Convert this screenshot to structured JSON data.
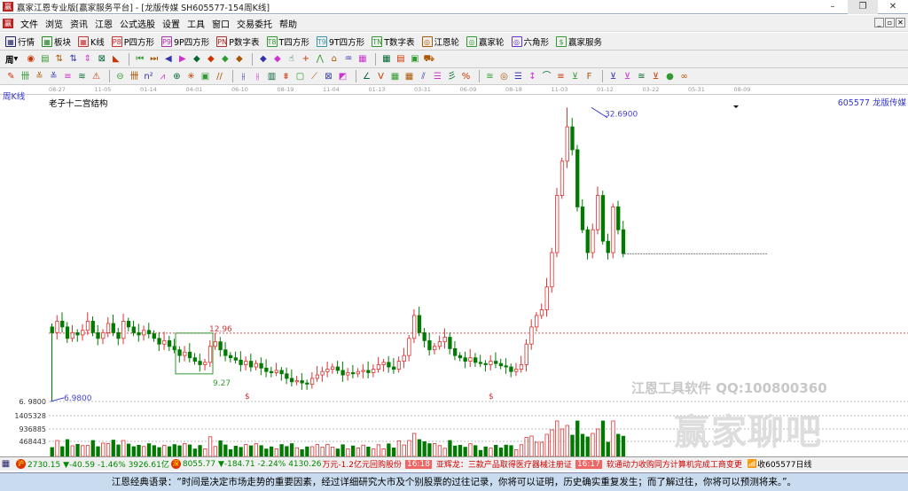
{
  "window": {
    "title": "赢家江恩专业版[赢家服务平台] - [龙版传媒  SH605577-154周K线]",
    "minimize": "–",
    "maximize": "❐",
    "close": "✕"
  },
  "menu": [
    "文件",
    "浏览",
    "资讯",
    "江恩",
    "公式选股",
    "设置",
    "工具",
    "窗口",
    "交易委托",
    "帮助"
  ],
  "mdi": {
    "minimize": "_",
    "restore": "▫",
    "close": "✕"
  },
  "toolbar1": [
    {
      "label": "行情",
      "icon": "grid-icon",
      "color": "#226"
    },
    {
      "label": "板块",
      "icon": "blocks-icon",
      "color": "#282"
    },
    {
      "label": "K线",
      "icon": "candle-icon",
      "color": "#c33"
    },
    {
      "label": "P四方形",
      "icon": "P8",
      "color": "#c33"
    },
    {
      "label": "9P四方形",
      "icon": "P9",
      "color": "#a3a"
    },
    {
      "label": "P数字表",
      "icon": "PN",
      "color": "#a33"
    },
    {
      "label": "T四方形",
      "icon": "T8",
      "color": "#393"
    },
    {
      "label": "9T四方形",
      "icon": "T9",
      "color": "#39a"
    },
    {
      "label": "T数字表",
      "icon": "TN",
      "color": "#393"
    },
    {
      "label": "江恩轮",
      "icon": "◎",
      "color": "#a50"
    },
    {
      "label": "赢家轮",
      "icon": "◎",
      "color": "#393"
    },
    {
      "label": "六角形",
      "icon": "◎",
      "color": "#63c"
    },
    {
      "label": "赢家服务",
      "icon": "$",
      "color": "#393"
    }
  ],
  "toolbar2": {
    "period": "周",
    "icons": [
      "◉",
      "▤",
      "⇅",
      "⇅",
      "⇕",
      "⊠",
      "◣",
      "⏮",
      "⏭",
      "◀",
      "▶",
      "◆",
      "◆",
      "◆",
      "◆",
      "◆",
      "◆",
      "☝",
      "+",
      "⋀",
      "⌂",
      "♒",
      "▦",
      "▦",
      "▤",
      "▣",
      "⛟"
    ]
  },
  "toolbar3": {
    "icons": [
      "✎",
      "卌",
      "≚",
      "≚",
      "≡",
      "≋",
      "⚠",
      "⊖",
      "卌",
      "n²",
      "⩘",
      "⊕",
      "✳",
      "▣",
      "//",
      "⫲",
      "⫲",
      "▥",
      "⩩",
      "▢",
      "⟋",
      "⊠",
      "◩",
      "∠",
      "V",
      "▦",
      "▦",
      "⫽",
      "☰",
      "彡",
      "%",
      "≊",
      "◎",
      "☰",
      "↕",
      "⌒",
      "≡",
      "⊻",
      "F",
      "⊻",
      "⊻",
      "≊",
      "⊻",
      "●",
      "∞"
    ]
  },
  "date_axis": [
    "08-27",
    "11-05",
    "01-14",
    "04-01",
    "06-10",
    "08-19",
    "11-04",
    "01-13",
    "03-31",
    "06-09",
    "08-18",
    "11-03",
    "01-12",
    "03-22",
    "05-31",
    "08-09"
  ],
  "chart": {
    "period_label": "周K线",
    "indicator": "老子十二宫结构",
    "stock": "605577  龙版传媒",
    "high_label": "32.6900",
    "low_label": "6.9800",
    "low_axis": "6. 9800",
    "level_label": "12.96",
    "box_low_label": "9.27",
    "dollar_mark": "$",
    "volume_ticks": [
      "1405328",
      "936885",
      "468443"
    ],
    "watermark_tool": "江恩工具软件  QQ:100800360",
    "watermark_brand": "赢家聊吧"
  },
  "chart_data": {
    "type": "candlestick",
    "price_range": [
      6.98,
      32.69
    ],
    "closes": [
      13,
      14,
      13.5,
      12.5,
      13,
      12.8,
      13.2,
      14,
      13,
      12.5,
      13,
      13.8,
      13,
      12.5,
      14,
      13.5,
      13,
      12.8,
      13.2,
      12.9,
      12.5,
      12,
      12.3,
      11.8,
      11.5,
      11,
      11.3,
      10.8,
      10.5,
      10.2,
      10.4,
      11.8,
      12.2,
      11.5,
      11,
      10.8,
      10.6,
      10.2,
      10.5,
      10,
      10.3,
      9.9,
      9.6,
      9.5,
      9.7,
      9.4,
      9,
      8.7,
      8.8,
      8.6,
      8.5,
      9,
      9.3,
      9.6,
      9.8,
      10,
      9.7,
      9.3,
      9.5,
      9.4,
      9.6,
      9.7,
      9.5,
      9.8,
      10.2,
      10.4,
      10,
      9.8,
      10.5,
      11,
      12.5,
      14.5,
      13,
      12.3,
      11.5,
      11.8,
      12.2,
      12.6,
      11.6,
      11,
      10.8,
      10.5,
      10.8,
      10.4,
      10.3,
      10.2,
      10.5,
      10.3,
      10.1,
      10,
      9.6,
      9.8,
      10.2,
      12,
      13.5,
      14.5,
      15,
      17,
      20,
      25,
      28,
      31,
      29,
      24,
      22,
      20,
      22,
      25,
      21,
      20,
      24,
      22,
      19.9
    ]
  },
  "status": {
    "sh_label": "沪",
    "sh": "2730.15",
    "sh_chg": "▼-40.59",
    "sh_pct": "-1.46%",
    "sh_amt": "3926.61亿",
    "sz_label": "深",
    "sz": "8055.77",
    "sz_chg": "▼-184.71",
    "sz_pct": "-2.24%",
    "sz_amt": "4130.26",
    "news0": "万元-1.2亿元回购股份",
    "t1": "16:18",
    "news1": "亚辉龙：三款产品取得医疗器械注册证",
    "t2": "16:17",
    "news2": "软通动力收购同方计算机完成工商变更",
    "right": "收605577日线"
  },
  "quote": "江恩经典语录：“时间是决定市场走势的重要因素，经过详细研究大市及个别股票的过往记录，你将可以证明，历史确实重复发生；而了解过往，你将可以预测将来。”。",
  "colors": {
    "up": "#e03030",
    "down": "#007a00",
    "line": "#4444cc"
  }
}
